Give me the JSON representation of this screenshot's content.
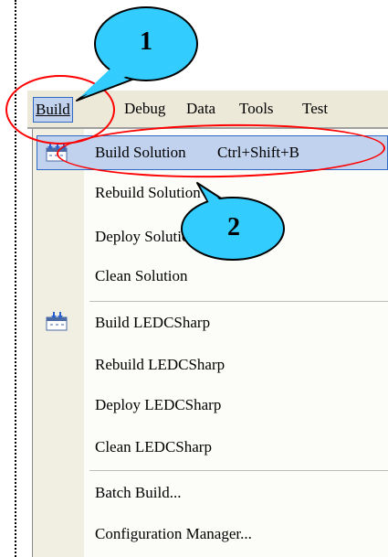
{
  "menubar": {
    "items": [
      {
        "label": "Build",
        "active": true
      },
      {
        "label": "Debug",
        "active": false
      },
      {
        "label": "Data",
        "active": false
      },
      {
        "label": "Tools",
        "active": false
      },
      {
        "label": "Test",
        "active": false
      }
    ]
  },
  "build_menu": {
    "items": [
      {
        "label": "Build Solution",
        "shortcut": "Ctrl+Shift+B",
        "icon": "build-solution-icon",
        "highlighted": true
      },
      {
        "label": "Rebuild Solution",
        "icon": null
      },
      {
        "label": "Deploy Solution",
        "icon": null
      },
      {
        "label": "Clean Solution",
        "icon": null
      },
      {
        "label": "Build LEDCSharp",
        "icon": "build-project-icon"
      },
      {
        "label": "Rebuild LEDCSharp",
        "icon": null
      },
      {
        "label": "Deploy LEDCSharp",
        "icon": null
      },
      {
        "label": "Clean LEDCSharp",
        "icon": null
      },
      {
        "label": "Batch Build...",
        "icon": null
      },
      {
        "label": "Configuration Manager...",
        "icon": null
      }
    ]
  },
  "annotations": {
    "callout_1": "1",
    "callout_2": "2"
  },
  "colors": {
    "highlight": "#c1d2ee",
    "highlight_border": "#316ac5",
    "annotation_red": "#ff0000",
    "callout_fill": "#33ccff",
    "menubar_bg": "#ece9d8"
  }
}
